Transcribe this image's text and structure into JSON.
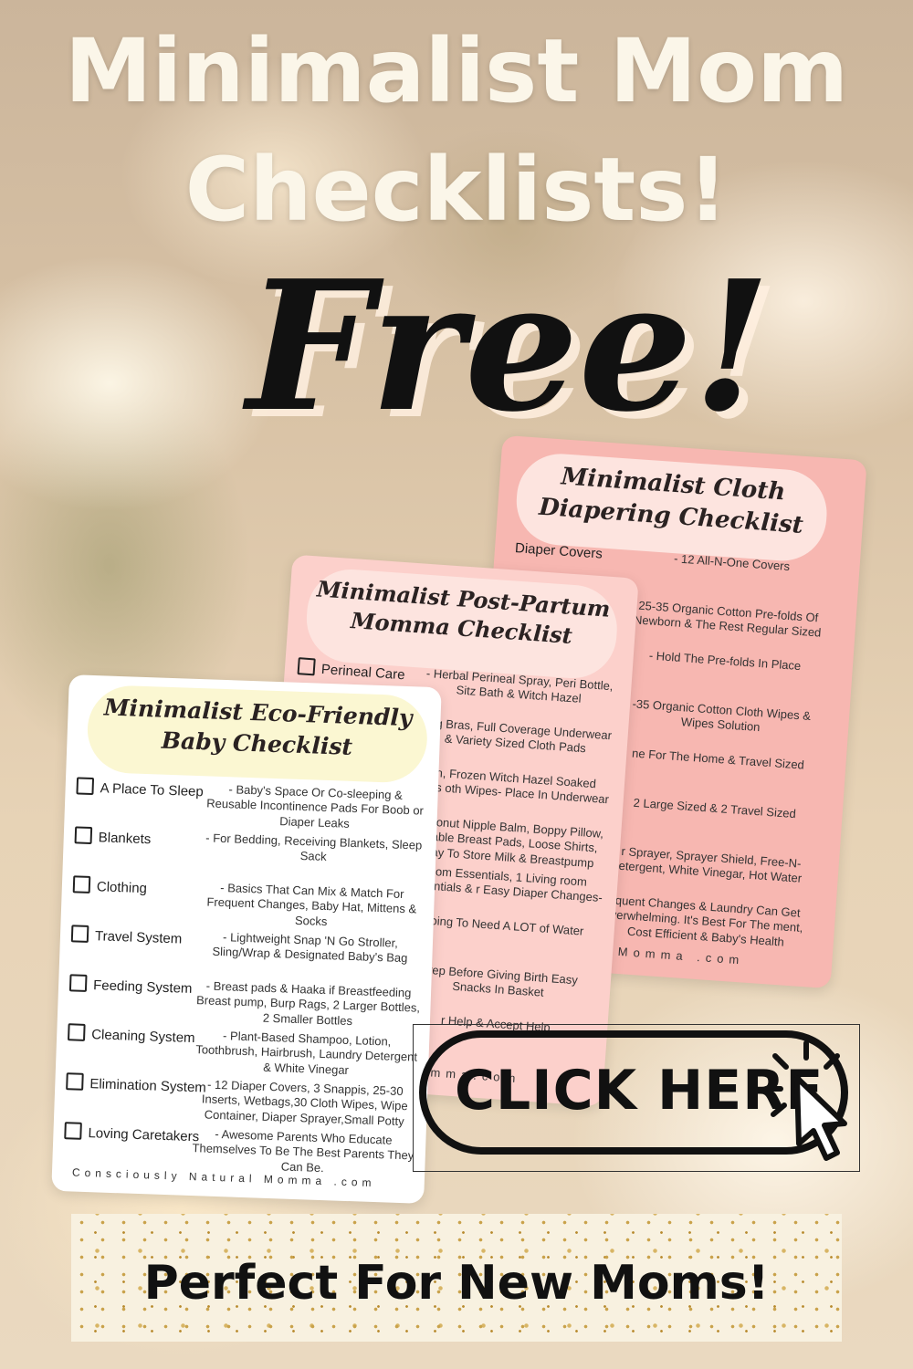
{
  "headline": {
    "line1": "Minimalist Mom",
    "line2": "Checklists!",
    "free": "Free!"
  },
  "cloth_sheet": {
    "title": "Minimalist Cloth Diapering Checklist",
    "rows": [
      {
        "label": "Diaper Covers",
        "desc": "- 12 All-N-One Covers"
      },
      {
        "label": "",
        "desc": "25-35 Organic Cotton Pre-folds Of Newborn & The Rest Regular Sized"
      },
      {
        "label": "",
        "desc": "- Hold The Pre-folds In Place"
      },
      {
        "label": "",
        "desc": "-35 Organic Cotton Cloth Wipes & Wipes Solution"
      },
      {
        "label": "",
        "desc": "ne For The Home & Travel Sized"
      },
      {
        "label": "",
        "desc": "2 Large Sized & 2 Travel Sized"
      },
      {
        "label": "",
        "desc": "r Sprayer, Sprayer Shield, Free-N- etergent, White Vinegar, Hot Water"
      },
      {
        "label": "",
        "desc": "quent Changes & Laundry Can Get verwhelming. It's Best For The ment, Cost Efficient & Baby's Health"
      }
    ],
    "footer": "ural Momma .com"
  },
  "postpartum_sheet": {
    "title": "Minimalist Post-Partum Momma Checklist",
    "rows": [
      {
        "label": "Perineal Care",
        "desc": "- Herbal Perineal Spray, Peri Bottle, Sitz Bath & Witch Hazel"
      },
      {
        "label": "",
        "desc": "sing Bras, Full Coverage Underwear & Variety Sized Cloth Pads"
      },
      {
        "label": "",
        "desc": "en, Frozen Witch Hazel Soaked Pads oth Wipes- Place In Underwear"
      },
      {
        "label": "",
        "desc": "Coconut Nipple Balm, Boppy Pillow, usable Breast Pads, Loose Shirts, Tray To Store Milk & Breastpump"
      },
      {
        "label": "",
        "desc": "room Essentials, 1 Living room Essentials & r Easy Diaper Changes-"
      },
      {
        "label": "",
        "desc": "Going To Need A LOT of Water"
      },
      {
        "label": "",
        "desc": "Prep Before Giving Birth Easy Snacks In Basket"
      },
      {
        "label": "",
        "desc": "r Help & Accept Help"
      }
    ],
    "footer": "Momma.com"
  },
  "baby_sheet": {
    "title": "Minimalist Eco-Friendly Baby Checklist",
    "rows": [
      {
        "label": "A Place To Sleep",
        "desc": "- Baby's Space Or Co-sleeping & Reusable Incontinence Pads For Boob or Diaper Leaks"
      },
      {
        "label": "Blankets",
        "desc": "- For Bedding, Receiving Blankets, Sleep Sack"
      },
      {
        "label": "Clothing",
        "desc": "- Basics That Can Mix & Match For Frequent Changes, Baby Hat, Mittens & Socks"
      },
      {
        "label": "Travel System",
        "desc": "- Lightweight Snap 'N Go Stroller, Sling/Wrap & Designated Baby's Bag"
      },
      {
        "label": "Feeding System",
        "desc": "- Breast pads & Haaka if Breastfeeding Breast pump, Burp Rags, 2 Larger Bottles, 2 Smaller Bottles"
      },
      {
        "label": "Cleaning System",
        "desc": "- Plant-Based Shampoo, Lotion, Toothbrush, Hairbrush, Laundry Detergent & White Vinegar"
      },
      {
        "label": "Elimination System",
        "desc": "- 12 Diaper Covers, 3 Snappis, 25-30 Inserts, Wetbags,30 Cloth Wipes, Wipe Container, Diaper Sprayer,Small Potty"
      },
      {
        "label": "Loving Caretakers",
        "desc": "- Awesome Parents Who Educate Themselves To Be The Best Parents They Can Be."
      }
    ],
    "footer": "Consciously Natural Momma .com"
  },
  "cta": {
    "label": "CLICK HERE"
  },
  "banner": {
    "label": "Perfect For New Moms!"
  },
  "colors": {
    "pink_sheet": "#f7b7b1",
    "pink_title": "#fde4df",
    "cream_title": "#fbf7d2",
    "headline": "#fbf6e9"
  },
  "icons": {
    "cursor": "cursor-click-icon",
    "checkbox": "checkbox-icon"
  }
}
